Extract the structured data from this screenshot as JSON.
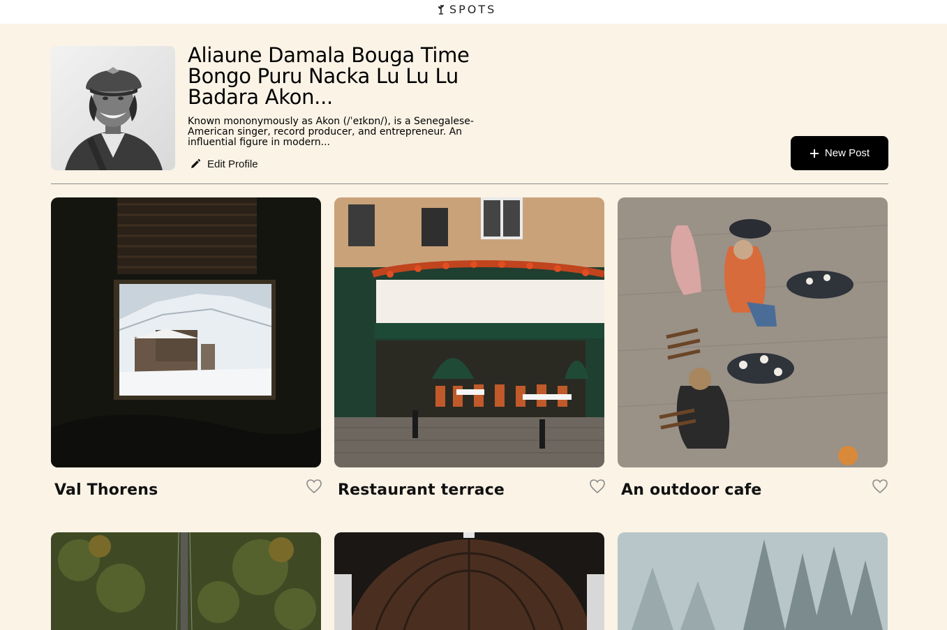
{
  "header": {
    "logo_text": "SPOTS",
    "logo_icon": "sprout-icon"
  },
  "profile": {
    "name": "Aliaune Damala Bouga Time Bongo Puru Nacka Lu Lu Lu Badara Akon...",
    "bio": "Known mononymously as Akon (/ˈeɪkɒn/), is a Senegalese-American singer, record producer, and entrepreneur. An influential figure in modern...",
    "edit_label": "Edit Profile",
    "edit_icon": "pencil-icon",
    "new_post_label": "New Post",
    "new_post_icon": "plus-icon"
  },
  "cards": [
    {
      "title": "Val Thorens",
      "liked": false,
      "image": "window-view-snowy-mountain-village"
    },
    {
      "title": "Restaurant terrace",
      "liked": false,
      "image": "parisian-restaurant-storefront"
    },
    {
      "title": "An outdoor cafe",
      "liked": false,
      "image": "people-at-outdoor-cafe-tables"
    },
    {
      "title": "",
      "liked": false,
      "image": "suspension-bridge-forest"
    },
    {
      "title": "",
      "liked": false,
      "image": "arched-wooden-station-roof"
    },
    {
      "title": "",
      "liked": false,
      "image": "misty-snowy-pine-forest"
    }
  ],
  "colors": {
    "background": "#FAF3E6",
    "topbar": "#FFFFFF",
    "button": "#000000",
    "button_text": "#FFFFFF",
    "divider": "#8A8A8A"
  }
}
